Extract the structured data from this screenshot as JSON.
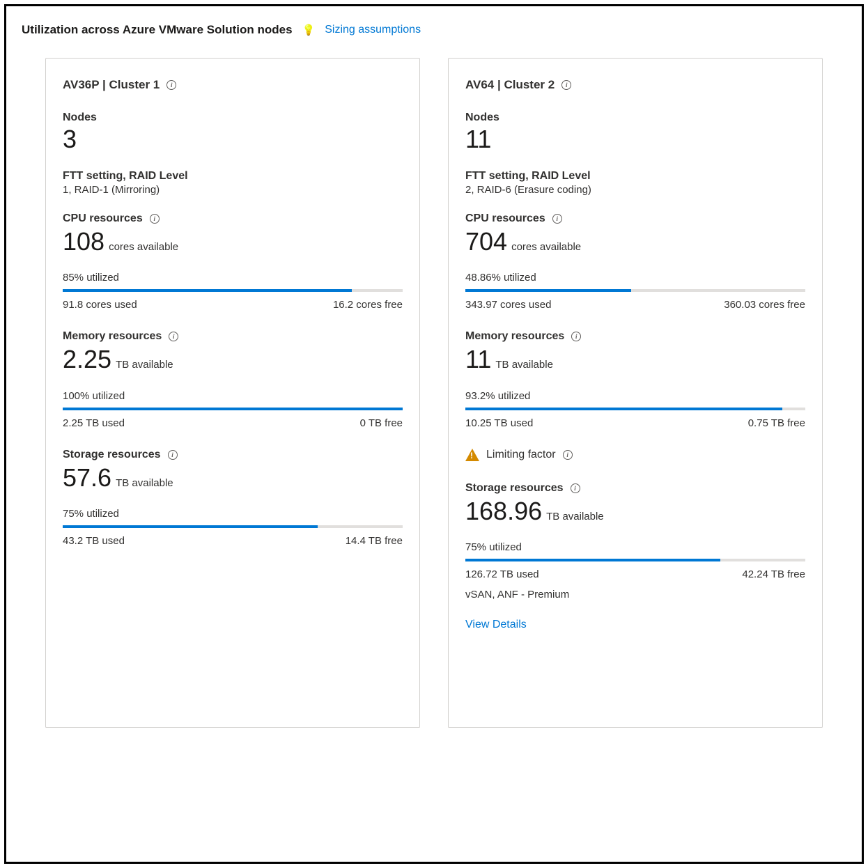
{
  "header": {
    "title": "Utilization across Azure VMware Solution nodes",
    "sizingLink": "Sizing assumptions"
  },
  "clusters": [
    {
      "title": "AV36P | Cluster 1",
      "nodesLabel": "Nodes",
      "nodes": "3",
      "fttLabel": "FTT setting, RAID Level",
      "fttValue": "1, RAID-1 (Mirroring)",
      "cpu": {
        "label": "CPU resources",
        "value": "108",
        "unit": "cores available",
        "utilized": "85% utilized",
        "pct": 85,
        "used": "91.8 cores used",
        "free": "16.2 cores free"
      },
      "memory": {
        "label": "Memory resources",
        "value": "2.25",
        "unit": "TB available",
        "utilized": "100% utilized",
        "pct": 100,
        "used": "2.25 TB used",
        "free": "0 TB free"
      },
      "storage": {
        "label": "Storage resources",
        "value": "57.6",
        "unit": "TB available",
        "utilized": "75% utilized",
        "pct": 75,
        "used": "43.2 TB used",
        "free": "14.4 TB free"
      }
    },
    {
      "title": "AV64 | Cluster 2",
      "nodesLabel": "Nodes",
      "nodes": "11",
      "fttLabel": "FTT setting, RAID Level",
      "fttValue": "2, RAID-6 (Erasure coding)",
      "cpu": {
        "label": "CPU resources",
        "value": "704",
        "unit": "cores available",
        "utilized": "48.86% utilized",
        "pct": 48.86,
        "used": "343.97 cores used",
        "free": "360.03 cores free"
      },
      "memory": {
        "label": "Memory resources",
        "value": "11",
        "unit": "TB available",
        "utilized": "93.2% utilized",
        "pct": 93.2,
        "used": "10.25 TB used",
        "free": "0.75 TB free"
      },
      "limitingFactor": "Limiting factor",
      "storage": {
        "label": "Storage resources",
        "value": "168.96",
        "unit": "TB available",
        "utilized": "75% utilized",
        "pct": 75,
        "used": "126.72 TB used",
        "free": "42.24 TB free"
      },
      "storageExtra": "vSAN, ANF - Premium",
      "viewDetails": "View Details"
    }
  ]
}
